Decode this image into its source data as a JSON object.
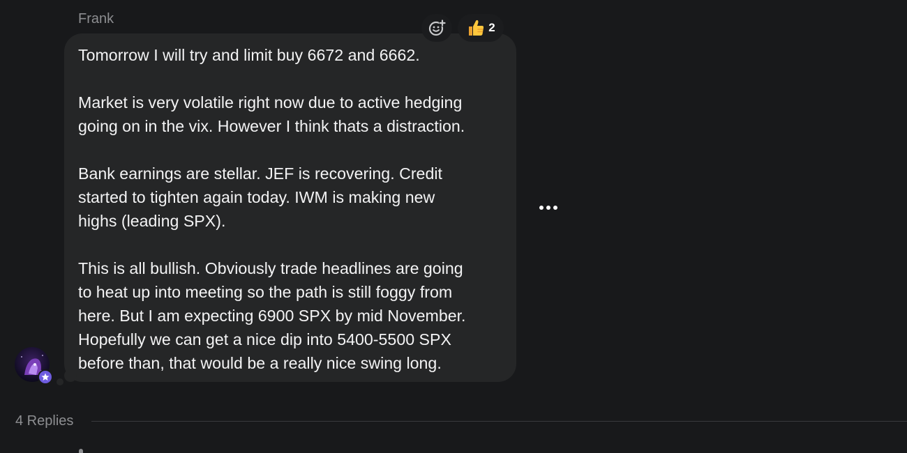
{
  "message": {
    "sender": "Frank",
    "paragraphs": [
      [
        "Tomorrow I will try and limit buy 6672 and 6662."
      ],
      [
        "Market is very volatile right now due to active hedging",
        "going on in the vix. However I think thats a distraction."
      ],
      [
        "Bank earnings are stellar. JEF is recovering. Credit",
        "started to tighten again today. IWM is making new",
        "highs (leading SPX)."
      ],
      [
        "This is all bullish. Obviously trade headlines are going",
        "to heat up into meeting so the path is still foggy from",
        "here. But I am expecting 6900 SPX by mid November.",
        "Hopefully we can get a nice dip into 5400-5500 SPX",
        "before than, that would be a really nice swing long."
      ]
    ]
  },
  "reactions": {
    "add_icon": "add-reaction-icon",
    "items": [
      {
        "emoji": "👍",
        "icon": "thumbs-up-icon",
        "count": "2"
      }
    ]
  },
  "more_icon": "more-horizontal-icon",
  "avatar": {
    "icon": "avatar-image",
    "badge_icon": "star-badge-icon",
    "badge_color": "#6e5ce0"
  },
  "replies": {
    "label": "4 Replies"
  },
  "colors": {
    "background": "#18191b",
    "bubble": "#252627",
    "text": "#f3f3f4",
    "muted": "#8d8e91"
  }
}
